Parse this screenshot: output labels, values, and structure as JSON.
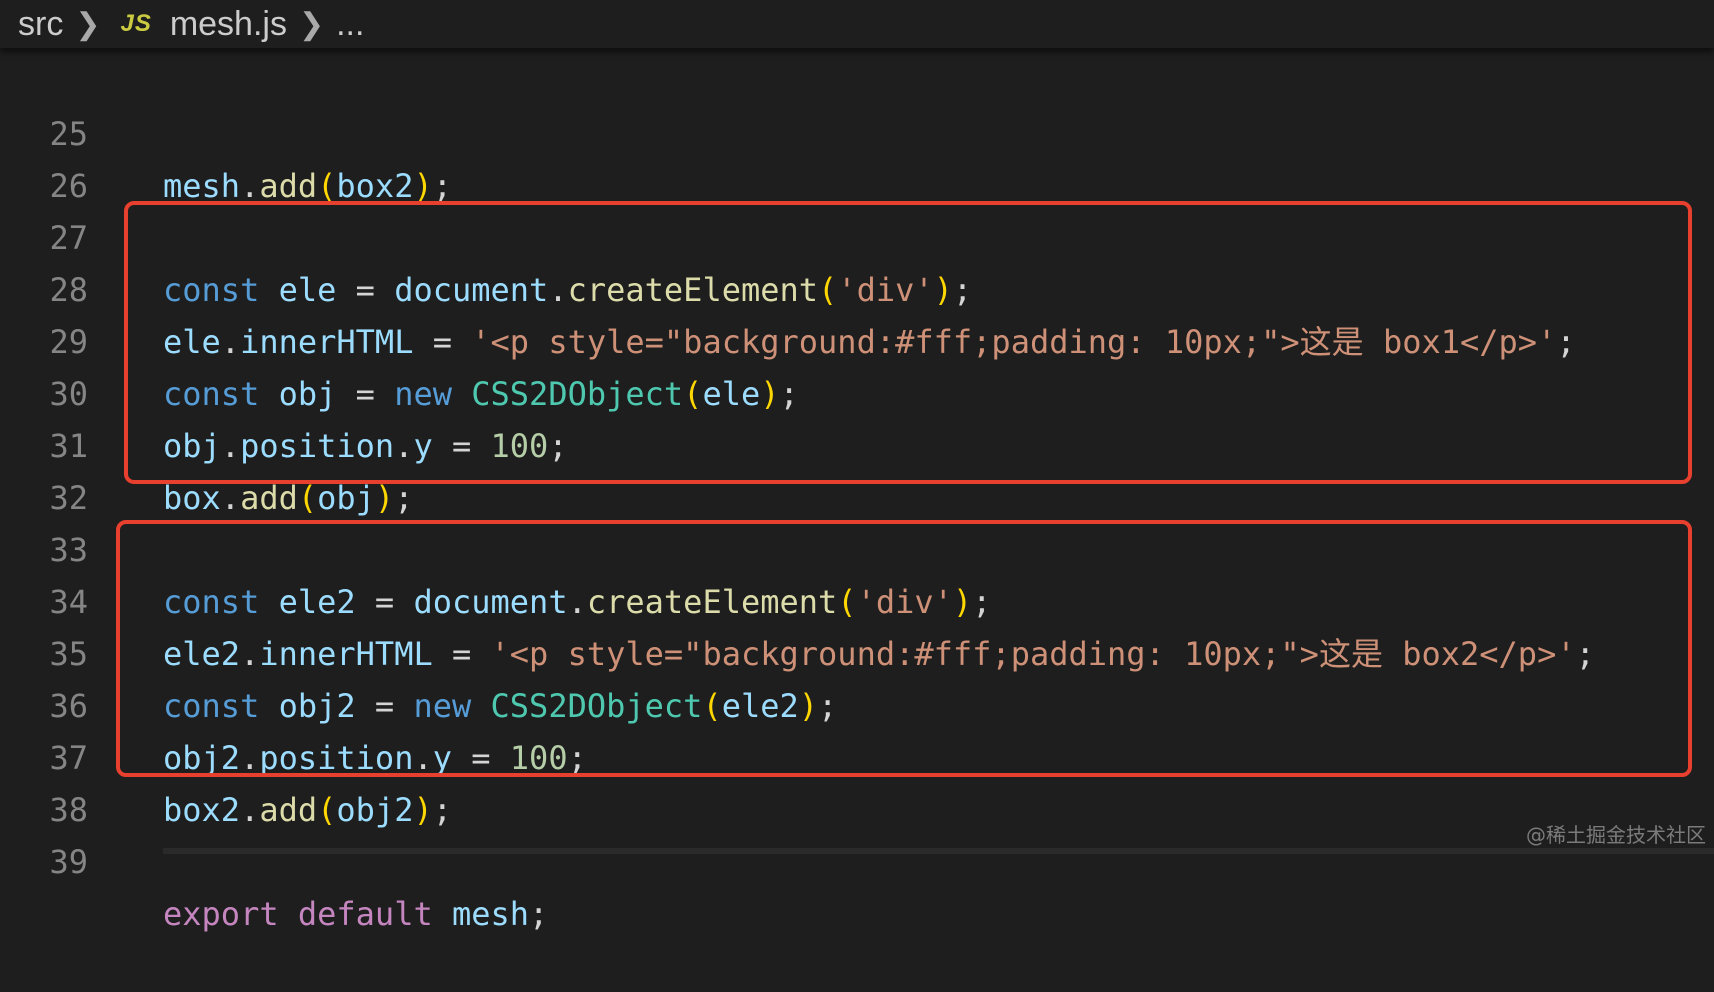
{
  "breadcrumb": {
    "folder": "src",
    "file_icon": "JS",
    "file": "mesh.js",
    "more": "..."
  },
  "peek_fragment": "(    );",
  "lines": [
    {
      "num": "25"
    },
    {
      "num": "26"
    },
    {
      "num": "27"
    },
    {
      "num": "28"
    },
    {
      "num": "29"
    },
    {
      "num": "30"
    },
    {
      "num": "31"
    },
    {
      "num": "32"
    },
    {
      "num": "33"
    },
    {
      "num": "34"
    },
    {
      "num": "35"
    },
    {
      "num": "36"
    },
    {
      "num": "37"
    },
    {
      "num": "38"
    },
    {
      "num": "39"
    }
  ],
  "tokens": {
    "l25": {
      "a": "mesh",
      "b": ".",
      "c": "add",
      "d": "(",
      "e": "box2",
      "f": ")",
      "g": ";"
    },
    "l27": {
      "a": "const",
      "b": " ",
      "c": "ele",
      "d": " = ",
      "e": "document",
      "f": ".",
      "g": "createElement",
      "h": "(",
      "i": "'div'",
      "j": ")",
      "k": ";"
    },
    "l28": {
      "a": "ele",
      "b": ".",
      "c": "innerHTML",
      "d": " = ",
      "e": "'<p style=\"background:#fff;padding: 10px;\">这是 box1</p>'",
      "f": ";"
    },
    "l29": {
      "a": "const",
      "b": " ",
      "c": "obj",
      "d": " = ",
      "e": "new",
      "f": " ",
      "g": "CSS2DObject",
      "h": "(",
      "i": "ele",
      "j": ")",
      "k": ";"
    },
    "l30": {
      "a": "obj",
      "b": ".",
      "c": "position",
      "d": ".",
      "e": "y",
      "f": " = ",
      "g": "100",
      "h": ";"
    },
    "l31": {
      "a": "box",
      "b": ".",
      "c": "add",
      "d": "(",
      "e": "obj",
      "f": ")",
      "g": ";"
    },
    "l33": {
      "a": "const",
      "b": " ",
      "c": "ele2",
      "d": " = ",
      "e": "document",
      "f": ".",
      "g": "createElement",
      "h": "(",
      "i": "'div'",
      "j": ")",
      "k": ";"
    },
    "l34": {
      "a": "ele2",
      "b": ".",
      "c": "innerHTML",
      "d": " = ",
      "e": "'<p style=\"background:#fff;padding: 10px;\">这是 box2</p>'",
      "f": ";"
    },
    "l35": {
      "a": "const",
      "b": " ",
      "c": "obj2",
      "d": " = ",
      "e": "new",
      "f": " ",
      "g": "CSS2DObject",
      "h": "(",
      "i": "ele2",
      "j": ")",
      "k": ";"
    },
    "l36": {
      "a": "obj2",
      "b": ".",
      "c": "position",
      "d": ".",
      "e": "y",
      "f": " = ",
      "g": "100",
      "h": ";"
    },
    "l37": {
      "a": "box2",
      "b": ".",
      "c": "add",
      "d": "(",
      "e": "obj2",
      "f": ")",
      "g": ";"
    },
    "l39": {
      "a": "export",
      "b": " ",
      "c": "default",
      "d": " ",
      "e": "mesh",
      "f": ";"
    }
  },
  "watermark": "@稀土掘金技术社区",
  "colors": {
    "background": "#1e1e1e",
    "highlight_box": "#e8402f",
    "keyword": "#569cd6",
    "variable": "#9cdcfe",
    "function": "#dcdcaa",
    "class": "#4ec9b0",
    "string": "#ce9178",
    "number": "#b5cea8",
    "export_keyword": "#c586c0"
  }
}
